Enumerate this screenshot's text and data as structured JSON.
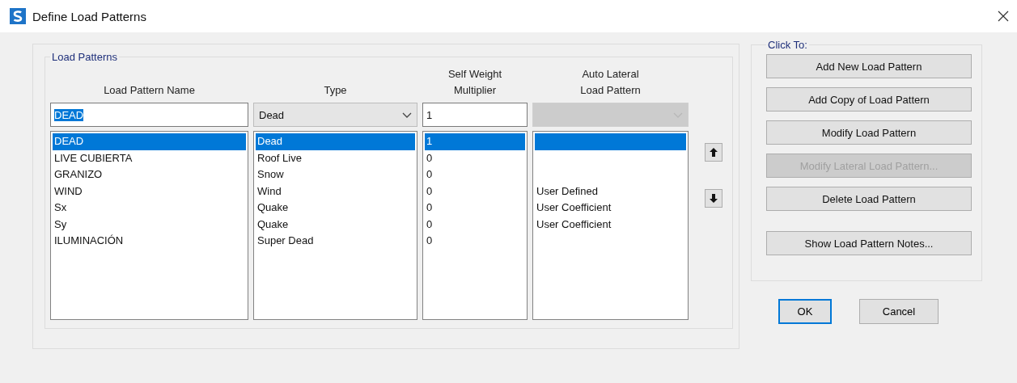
{
  "window": {
    "title": "Define Load Patterns"
  },
  "load_patterns": {
    "title": "Load Patterns",
    "columns": [
      "Load Pattern Name",
      "Type",
      "Self Weight\nMultiplier",
      "Auto Lateral\nLoad Pattern"
    ],
    "editor": {
      "name": "DEAD",
      "type": "Dead",
      "multiplier": "1",
      "lateral": {
        "disabled": true
      }
    },
    "rows": [
      {
        "name": "DEAD",
        "type": "Dead",
        "multiplier": "1",
        "lateral": "",
        "selected": true
      },
      {
        "name": "LIVE CUBIERTA",
        "type": "Roof Live",
        "multiplier": "0",
        "lateral": "",
        "selected": false
      },
      {
        "name": "GRANIZO",
        "type": "Snow",
        "multiplier": "0",
        "lateral": "",
        "selected": false
      },
      {
        "name": "WIND",
        "type": "Wind",
        "multiplier": "0",
        "lateral": "User Defined",
        "selected": false
      },
      {
        "name": "Sx",
        "type": "Quake",
        "multiplier": "0",
        "lateral": "User Coefficient",
        "selected": false
      },
      {
        "name": "Sy",
        "type": "Quake",
        "multiplier": "0",
        "lateral": "User Coefficient",
        "selected": false
      },
      {
        "name": "ILUMINACIÓN",
        "type": "Super Dead",
        "multiplier": "0",
        "lateral": "",
        "selected": false
      }
    ]
  },
  "click_to": {
    "title": "Click To:",
    "buttons": [
      {
        "label": "Add New Load Pattern",
        "disabled": false
      },
      {
        "label": "Add Copy of Load Pattern",
        "disabled": false
      },
      {
        "label": "Modify Load Pattern",
        "disabled": false
      },
      {
        "label": "Modify Lateral Load Pattern...",
        "disabled": true
      },
      {
        "label": "Delete Load Pattern",
        "disabled": false
      },
      {
        "label": "Show Load Pattern Notes...",
        "disabled": false
      }
    ]
  },
  "footer_buttons": [
    {
      "label": "OK",
      "default": true
    },
    {
      "label": "Cancel",
      "default": false
    }
  ]
}
